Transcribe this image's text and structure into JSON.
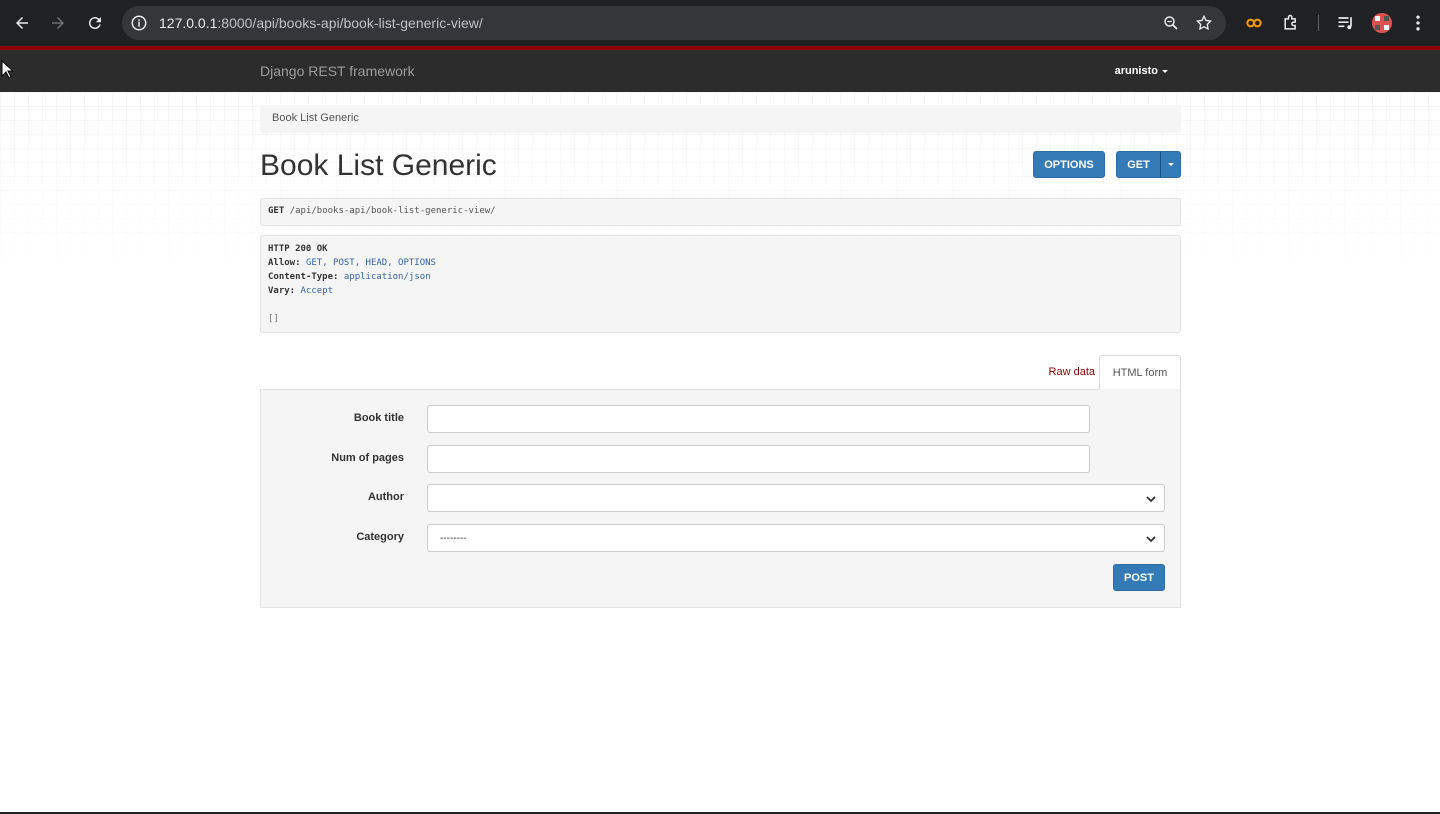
{
  "browser": {
    "url_host": "127.0.0.1",
    "url_rest": ":8000/api/books-api/book-list-generic-view/",
    "icons": [
      "back-icon",
      "forward-icon",
      "reload-icon",
      "site-info-icon",
      "zoom-icon",
      "bookmark-star-icon",
      "extension-icon",
      "puzzle-icon",
      "media-icon",
      "profile-avatar",
      "more-menu-icon"
    ]
  },
  "navbar": {
    "brand": "Django REST framework",
    "user": "arunisto"
  },
  "breadcrumb": "Book List Generic",
  "page_title": "Book List Generic",
  "buttons": {
    "options": "OPTIONS",
    "get": "GET",
    "post": "POST"
  },
  "request": {
    "method": "GET",
    "path": "/api/books-api/book-list-generic-view/"
  },
  "response": {
    "status": "HTTP 200 OK",
    "allow_key": "Allow:",
    "allow_val": "GET, POST, HEAD, OPTIONS",
    "ctype_key": "Content-Type:",
    "ctype_val": "application/json",
    "vary_key": "Vary:",
    "vary_val": "Accept",
    "body": "[]"
  },
  "tabs": {
    "raw": "Raw data",
    "html": "HTML form"
  },
  "form": {
    "book_title_label": "Book title",
    "book_title_value": "",
    "num_pages_label": "Num of pages",
    "num_pages_value": "",
    "author_label": "Author",
    "author_value": "",
    "category_label": "Category",
    "category_value": "--------"
  },
  "colors": {
    "primary": "#337ab7",
    "navbar": "#2c2c2c",
    "accent_red": "#8b0000"
  }
}
